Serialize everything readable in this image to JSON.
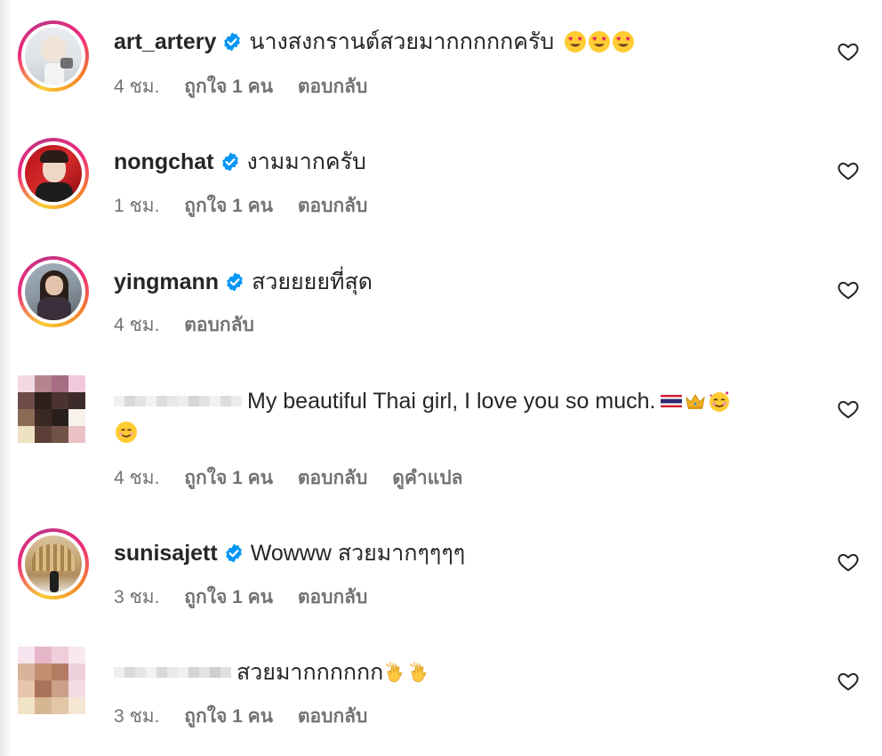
{
  "comments": [
    {
      "username": "art_artery",
      "verified": true,
      "text": "นางสงกรานต์สวยมากกกกกครับ",
      "emojis": [
        "heart-eyes-emoji",
        "heart-eyes-emoji",
        "heart-eyes-emoji"
      ],
      "time": "4 ชม.",
      "likes": "ถูกใจ 1 คน",
      "reply": "ตอบกลับ",
      "translate": ""
    },
    {
      "username": "nongchat",
      "verified": true,
      "text": "งามมากครับ",
      "time": "1 ชม.",
      "likes": "ถูกใจ 1 คน",
      "reply": "ตอบกลับ"
    },
    {
      "username": "yingmann",
      "verified": true,
      "text": "สวยยยยที่สุด",
      "time": "4 ชม.",
      "reply": "ตอบกลับ"
    },
    {
      "username": "",
      "username_hidden": true,
      "text": "My beautiful Thai girl, I love you so much.",
      "emojis": [
        "thai-flag-emoji",
        "crown-emoji",
        "smiling-hearts-emoji",
        "smiling-face-emoji"
      ],
      "time": "4 ชม.",
      "likes": "ถูกใจ 1 คน",
      "reply": "ตอบกลับ",
      "translate": "ดูคำแปล"
    },
    {
      "username": "sunisajett",
      "verified": true,
      "text": "Wowww สวยมากๆๆๆๆ",
      "time": "3 ชม.",
      "likes": "ถูกใจ 1 คน",
      "reply": "ตอบกลับ"
    },
    {
      "username": "",
      "username_hidden": true,
      "text": "สวยมากกกกกก",
      "emojis": [
        "clapping-hands-emoji",
        "clapping-hands-emoji"
      ],
      "time": "3 ชม.",
      "likes": "ถูกใจ 1 คน",
      "reply": "ตอบกลับ"
    }
  ],
  "colors": {
    "verified_blue": "#0095f6",
    "meta_gray": "#737373",
    "text_dark": "#262626"
  }
}
